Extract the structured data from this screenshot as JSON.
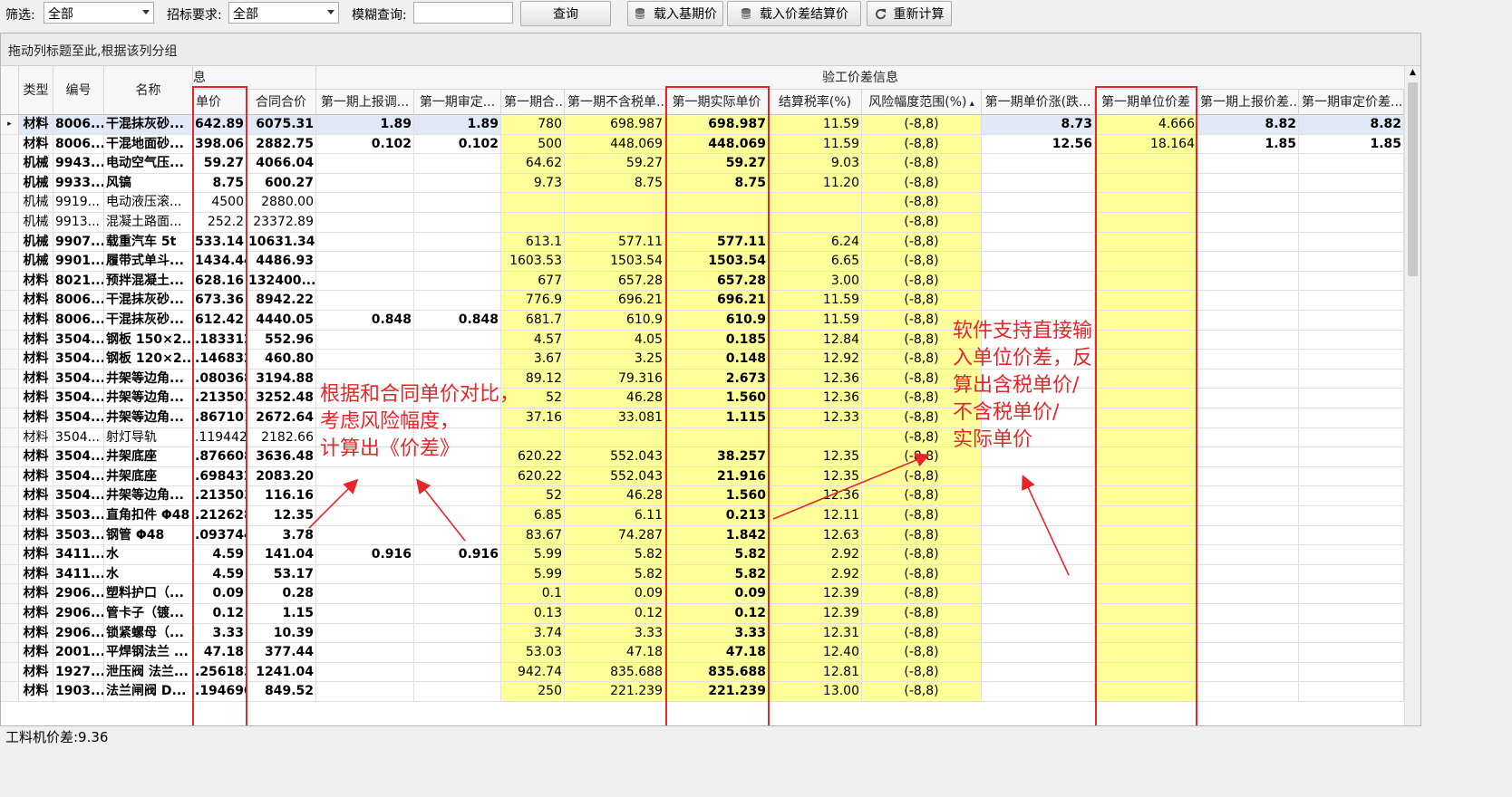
{
  "toolbar": {
    "filter_label": "筛选:",
    "filter_value": "全部",
    "bid_req_label": "招标要求:",
    "bid_req_value": "全部",
    "fuzzy_label": "模糊查询:",
    "fuzzy_value": "",
    "query_btn": "查询",
    "load_base_btn": "载入基期价",
    "load_diff_btn": "载入价差结算价",
    "recalc_btn": "重新计算"
  },
  "grid": {
    "group_hint": "拖动列标题至此,根据该列分组",
    "band_left": "息",
    "band_right": "验工价差信息",
    "headers": [
      "类型",
      "编号",
      "名称",
      "单价",
      "合同合价",
      "第一期上报调...",
      "第一期审定...",
      "第一期合...",
      "第一期不含税单...",
      "第一期实际单价",
      "结算税率(%)",
      "风险幅度范围(%)",
      "第一期单价涨(跌...",
      "第一期单位价差",
      "第一期上报价差...",
      "第一期审定价差..."
    ],
    "rows": [
      [
        "材料",
        "8006...",
        "干混抹灰砂...",
        "642.89",
        "6075.31",
        "1.89",
        "1.89",
        "780",
        "698.987",
        "698.987",
        "11.59",
        "(-8,8)",
        "8.73",
        "4.666",
        "8.82",
        "8.82"
      ],
      [
        "材料",
        "8006...",
        "干混地面砂...",
        "398.06",
        "2882.75",
        "0.102",
        "0.102",
        "500",
        "448.069",
        "448.069",
        "11.59",
        "(-8,8)",
        "12.56",
        "18.164",
        "1.85",
        "1.85"
      ],
      [
        "机械",
        "9943...",
        "电动空气压...",
        "59.27",
        "4066.04",
        "",
        "",
        "64.62",
        "59.27",
        "59.27",
        "9.03",
        "(-8,8)",
        "",
        "",
        "",
        ""
      ],
      [
        "机械",
        "9933...",
        "风镐",
        "8.75",
        "600.27",
        "",
        "",
        "9.73",
        "8.75",
        "8.75",
        "11.20",
        "(-8,8)",
        "",
        "",
        "",
        ""
      ],
      [
        "机械",
        "9919...",
        "电动液压滚...",
        "4500",
        "2880.00",
        "",
        "",
        "",
        "",
        "",
        "",
        "(-8,8)",
        "",
        "",
        "",
        ""
      ],
      [
        "机械",
        "9913...",
        "混凝土路面...",
        "252.2",
        "23372.89",
        "",
        "",
        "",
        "",
        "",
        "",
        "(-8,8)",
        "",
        "",
        "",
        ""
      ],
      [
        "机械",
        "9907...",
        "载重汽车 5t",
        "533.14",
        "10631.34",
        "",
        "",
        "613.1",
        "577.11",
        "577.11",
        "6.24",
        "(-8,8)",
        "",
        "",
        "",
        ""
      ],
      [
        "机械",
        "9901...",
        "履带式单斗...",
        "1434.44",
        "4486.93",
        "",
        "",
        "1603.53",
        "1503.54",
        "1503.54",
        "6.65",
        "(-8,8)",
        "",
        "",
        "",
        ""
      ],
      [
        "材料",
        "8021...",
        "预拌混凝土...",
        "628.16",
        "132400....",
        "",
        "",
        "677",
        "657.28",
        "657.28",
        "3.00",
        "(-8,8)",
        "",
        "",
        "",
        ""
      ],
      [
        "材料",
        "8006...",
        "干混抹灰砂...",
        "673.36",
        "8942.22",
        "",
        "",
        "776.9",
        "696.21",
        "696.21",
        "11.59",
        "(-8,8)",
        "",
        "",
        "",
        ""
      ],
      [
        "材料",
        "8006...",
        "干混抹灰砂...",
        "612.42",
        "4440.05",
        "0.848",
        "0.848",
        "681.7",
        "610.9",
        "610.9",
        "11.59",
        "(-8,8)",
        "",
        "",
        "",
        ""
      ],
      [
        "材料",
        "3504...",
        "钢板 150×2...",
        ".183312",
        "552.96",
        "",
        "",
        "4.57",
        "4.05",
        "0.185",
        "12.84",
        "(-8,8)",
        "",
        "",
        "",
        ""
      ],
      [
        "材料",
        "3504...",
        "钢板 120×2...",
        ".146832",
        "460.80",
        "",
        "",
        "3.67",
        "3.25",
        "0.148",
        "12.92",
        "(-8,8)",
        "",
        "",
        "",
        ""
      ],
      [
        "材料",
        "3504...",
        "井架等边角...",
        ".080368",
        "3194.88",
        "",
        "",
        "89.12",
        "79.316",
        "2.673",
        "12.36",
        "(-8,8)",
        "",
        "",
        "",
        ""
      ],
      [
        "材料",
        "3504...",
        "井架等边角...",
        ".213503",
        "3252.48",
        "",
        "",
        "52",
        "46.28",
        "1.560",
        "12.36",
        "(-8,8)",
        "",
        "",
        "",
        ""
      ],
      [
        "材料",
        "3504...",
        "井架等边角...",
        ".867101",
        "2672.64",
        "",
        "",
        "37.16",
        "33.081",
        "1.115",
        "12.33",
        "(-8,8)",
        "",
        "",
        "",
        ""
      ],
      [
        "材料",
        "3504...",
        "射灯导轨",
        ".119442",
        "2182.66",
        "",
        "",
        "",
        "",
        "",
        "",
        "(-8,8)",
        "",
        "",
        "",
        ""
      ],
      [
        "材料",
        "3504...",
        "井架底座",
        ".876608",
        "3636.48",
        "",
        "",
        "620.22",
        "552.043",
        "38.257",
        "12.35",
        "(-8,8)",
        "",
        "",
        "",
        ""
      ],
      [
        "材料",
        "3504...",
        "井架底座",
        ".698432",
        "2083.20",
        "",
        "",
        "620.22",
        "552.043",
        "21.916",
        "12.35",
        "(-8,8)",
        "",
        "",
        "",
        ""
      ],
      [
        "材料",
        "3504...",
        "井架等边角...",
        ".213503",
        "116.16",
        "",
        "",
        "52",
        "46.28",
        "1.560",
        "12.36",
        "(-8,8)",
        "",
        "",
        "",
        ""
      ],
      [
        "材料",
        "3503...",
        "直角扣件 Φ48",
        ".212628",
        "12.35",
        "",
        "",
        "6.85",
        "6.11",
        "0.213",
        "12.11",
        "(-8,8)",
        "",
        "",
        "",
        ""
      ],
      [
        "材料",
        "3503...",
        "钢管 Φ48",
        ".093744",
        "3.78",
        "",
        "",
        "83.67",
        "74.287",
        "1.842",
        "12.63",
        "(-8,8)",
        "",
        "",
        "",
        ""
      ],
      [
        "材料",
        "3411...",
        "水",
        "4.59",
        "141.04",
        "0.916",
        "0.916",
        "5.99",
        "5.82",
        "5.82",
        "2.92",
        "(-8,8)",
        "",
        "",
        "",
        ""
      ],
      [
        "材料",
        "3411...",
        "水",
        "4.59",
        "53.17",
        "",
        "",
        "5.99",
        "5.82",
        "5.82",
        "2.92",
        "(-8,8)",
        "",
        "",
        "",
        ""
      ],
      [
        "材料",
        "2906...",
        "塑料护口（...",
        "0.09",
        "0.28",
        "",
        "",
        "0.1",
        "0.09",
        "0.09",
        "12.39",
        "(-8,8)",
        "",
        "",
        "",
        ""
      ],
      [
        "材料",
        "2906...",
        "管卡子（镀...",
        "0.12",
        "1.15",
        "",
        "",
        "0.13",
        "0.12",
        "0.12",
        "12.39",
        "(-8,8)",
        "",
        "",
        "",
        ""
      ],
      [
        "材料",
        "2906...",
        "锁紧螺母（...",
        "3.33",
        "10.39",
        "",
        "",
        "3.74",
        "3.33",
        "3.33",
        "12.31",
        "(-8,8)",
        "",
        "",
        "",
        ""
      ],
      [
        "材料",
        "2001...",
        "平焊钢法兰 ...",
        "47.18",
        "377.44",
        "",
        "",
        "53.03",
        "47.18",
        "47.18",
        "12.40",
        "(-8,8)",
        "",
        "",
        "",
        ""
      ],
      [
        "材料",
        "1927...",
        "泄压阀 法兰...",
        ".256183",
        "1241.04",
        "",
        "",
        "942.74",
        "835.688",
        "835.688",
        "12.81",
        "(-8,8)",
        "",
        "",
        "",
        ""
      ],
      [
        "材料",
        "1903...",
        "法兰闸阀 D...",
        ".194690",
        "849.52",
        "",
        "",
        "250",
        "221.239",
        "221.239",
        "13.00",
        "(-8,8)",
        "",
        "",
        "",
        ""
      ]
    ]
  },
  "annotations": {
    "left_note": [
      "根据和合同单价对比，",
      "考虑风险幅度，",
      "计算出《价差》"
    ],
    "right_note": [
      "软件支持直接输",
      "入单位价差，反",
      "算出含税单价/",
      "不含税单价/",
      "实际单价"
    ]
  },
  "status": {
    "text": "工料机价差:9.36"
  },
  "colors": {
    "highlight_yellow": "#ffff99",
    "annotation_red": "#e8262a",
    "selected_row": "#dfe9f7"
  }
}
